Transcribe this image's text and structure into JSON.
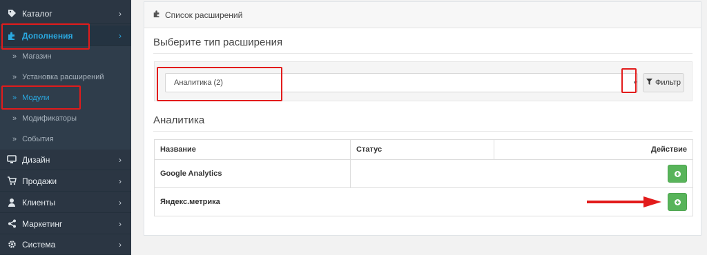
{
  "sidebar": {
    "items": [
      {
        "label": "Каталог",
        "icon": "tag-icon"
      },
      {
        "label": "Дополнения",
        "icon": "puzzle-icon"
      },
      {
        "label": "Дизайн",
        "icon": "desktop-icon"
      },
      {
        "label": "Продажи",
        "icon": "cart-icon"
      },
      {
        "label": "Клиенты",
        "icon": "user-icon"
      },
      {
        "label": "Маркетинг",
        "icon": "share-icon"
      },
      {
        "label": "Система",
        "icon": "gear-icon"
      }
    ],
    "subitems": [
      {
        "label": "Магазин"
      },
      {
        "label": "Установка расширений"
      },
      {
        "label": "Модули"
      },
      {
        "label": "Модификаторы"
      },
      {
        "label": "События"
      }
    ]
  },
  "panel": {
    "title": "Список расширений"
  },
  "choose": {
    "title": "Выберите тип расширения",
    "selected": "Аналитика (2)",
    "filter_label": "Фильтр"
  },
  "section": {
    "title": "Аналитика"
  },
  "table": {
    "headers": [
      "Название",
      "Статус",
      "Действие"
    ],
    "rows": [
      {
        "name": "Google Analytics",
        "status": ""
      },
      {
        "name": "Яндекс.метрика",
        "status": ""
      }
    ]
  },
  "colors": {
    "accent": "#2aa8e0",
    "highlight_red": "#e21b1b",
    "add_button_green": "#58b45a"
  }
}
